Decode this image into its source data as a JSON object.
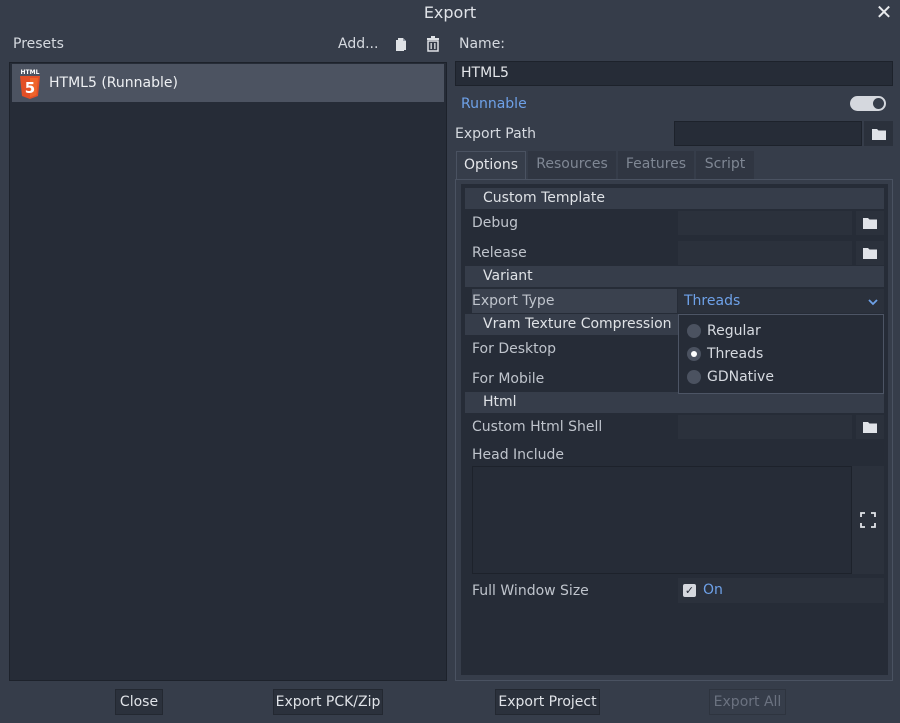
{
  "dialog": {
    "title": "Export"
  },
  "presets": {
    "label": "Presets",
    "add_label": "Add...",
    "items": [
      {
        "label": "HTML5 (Runnable)",
        "icon": "html5-icon"
      }
    ]
  },
  "preset_settings": {
    "name_label": "Name:",
    "name_value": "HTML5",
    "runnable_label": "Runnable",
    "runnable_on": true,
    "export_path_label": "Export Path",
    "export_path_value": ""
  },
  "tabs": [
    {
      "label": "Options",
      "active": true
    },
    {
      "label": "Resources"
    },
    {
      "label": "Features"
    },
    {
      "label": "Script"
    }
  ],
  "options": {
    "sections": {
      "custom_template": "Custom Template",
      "variant": "Variant",
      "vram": "Vram Texture Compression",
      "html": "Html"
    },
    "labels": {
      "debug": "Debug",
      "release": "Release",
      "export_type": "Export Type",
      "for_desktop": "For Desktop",
      "for_mobile": "For Mobile",
      "custom_html_shell": "Custom Html Shell",
      "head_include": "Head Include",
      "full_window_size": "Full Window Size"
    },
    "export_type_value": "Threads",
    "export_type_options": [
      "Regular",
      "Threads",
      "GDNative"
    ],
    "full_window_size_value": "On"
  },
  "footer": {
    "close": "Close",
    "export_pck": "Export PCK/Zip",
    "export_project": "Export Project",
    "export_all": "Export All"
  },
  "colors": {
    "background": "#363d4a",
    "panel": "#262c37",
    "accent": "#6ea1e8",
    "selected_item": "#4c5361"
  }
}
